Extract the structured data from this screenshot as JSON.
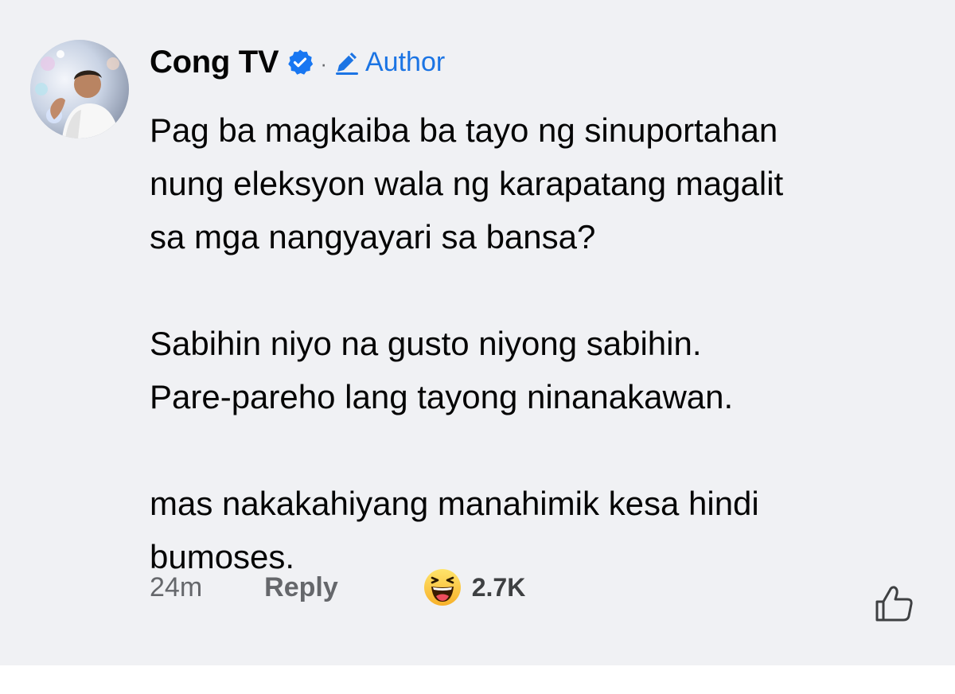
{
  "comment": {
    "author_name": "Cong TV",
    "separator": "·",
    "badge_label": "Author",
    "paragraphs": [
      {
        "lines": [
          "Pag ba magkaiba ba tayo ng sinuportahan",
          "nung eleksyon wala ng karapatang magalit",
          "sa mga nangyayari sa bansa?"
        ]
      },
      {
        "lines": [
          "Sabihin niyo na gusto niyong sabihin.",
          "Pare-pareho lang tayong ninanakawan."
        ]
      },
      {
        "lines": [
          "mas nakakahiyang manahimik kesa hindi",
          "bumoses."
        ]
      }
    ],
    "timestamp": "24m",
    "reply_label": "Reply",
    "reaction_count": "2.7K"
  },
  "icons": {
    "verified": "verified-badge-icon",
    "author": "pencil-icon",
    "reaction": "haha-emoji-icon",
    "like": "thumbs-up-icon"
  },
  "colors": {
    "background": "#f0f1f4",
    "name": "#050505",
    "meta": "#65676b",
    "accent": "#1b74e4",
    "verified": "#1877f2"
  }
}
